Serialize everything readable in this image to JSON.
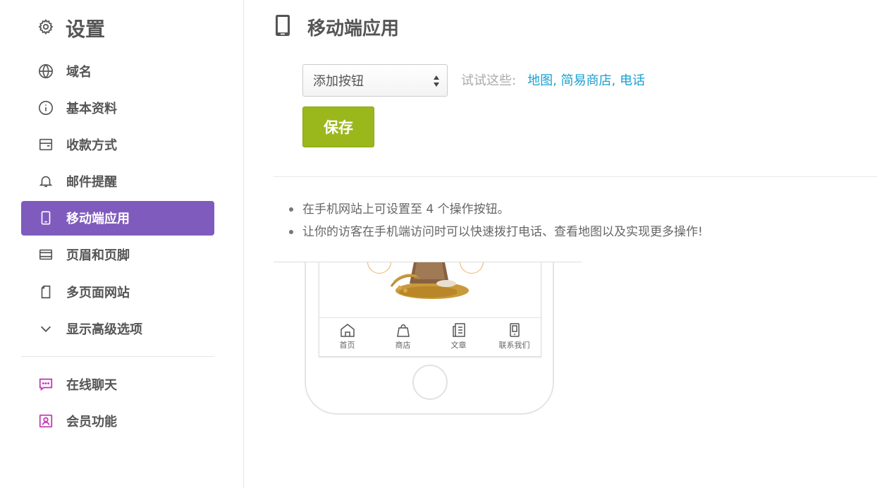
{
  "sidebar": {
    "title": "设置",
    "items": [
      {
        "label": "域名",
        "icon": "globe-icon"
      },
      {
        "label": "基本资料",
        "icon": "info-icon"
      },
      {
        "label": "收款方式",
        "icon": "wallet-icon"
      },
      {
        "label": "邮件提醒",
        "icon": "bell-icon"
      },
      {
        "label": "移动端应用",
        "icon": "mobile-icon",
        "active": true
      },
      {
        "label": "页眉和页脚",
        "icon": "header-footer-icon"
      },
      {
        "label": "多页面网站",
        "icon": "pages-icon"
      },
      {
        "label": "显示高级选项",
        "icon": "chevron-down-icon"
      }
    ],
    "extras": [
      {
        "label": "在线聊天",
        "icon": "chat-icon"
      },
      {
        "label": "会员功能",
        "icon": "member-icon"
      }
    ]
  },
  "main": {
    "title": "移动端应用",
    "select_value": "添加按钮",
    "hint_prefix": "试试这些:",
    "hint_links": [
      "地图",
      "简易商店",
      "电话"
    ],
    "save_label": "保存",
    "bullets": [
      "在手机网站上可设置至 4 个操作按钮。",
      "让你的访客在手机端访问时可以快速拨打电话、查看地图以及实现更多操作!"
    ]
  },
  "phone": {
    "tabs": [
      {
        "label": "首页",
        "icon": "home-icon"
      },
      {
        "label": "商店",
        "icon": "bag-icon"
      },
      {
        "label": "文章",
        "icon": "article-icon"
      },
      {
        "label": "联系我们",
        "icon": "contact-phone-icon"
      }
    ]
  },
  "colors": {
    "accent_purple": "#7f5bbd",
    "save_green": "#9ab81c",
    "link_blue": "#1aa0d0",
    "chat_icon_magenta": "#c13fb5"
  }
}
